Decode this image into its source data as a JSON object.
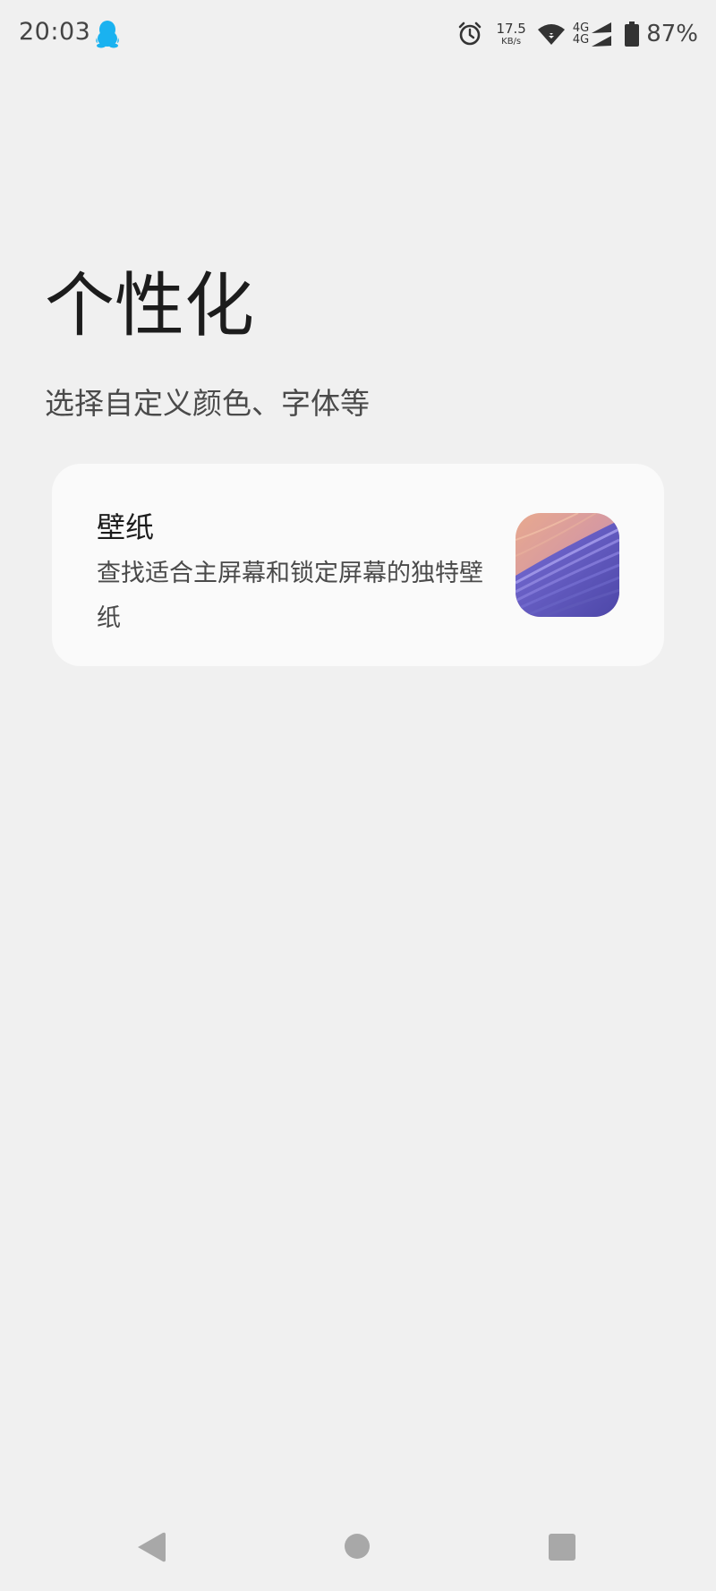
{
  "status_bar": {
    "time": "20:03",
    "net_speed_value": "17.5",
    "net_speed_unit": "KB/s",
    "cell_label_1": "4G",
    "cell_label_2": "4G",
    "battery_text": "87%",
    "battery_level": 0.87,
    "icons": [
      "qq-icon",
      "alarm-icon",
      "wifi-icon",
      "signal-icon",
      "battery-icon"
    ],
    "qq_color": "#1ab2f0"
  },
  "header": {
    "title": "个性化",
    "subtitle": "选择自定义颜色、字体等"
  },
  "wallpaper_card": {
    "title": "壁纸",
    "description": "查找适合主屏幕和锁定屏幕的独特壁纸",
    "thumbnail_colors": [
      "#e8a98e",
      "#c98fa6",
      "#6a5fc8",
      "#4d47a8"
    ]
  },
  "nav_bar": {
    "icons": [
      "back-icon",
      "home-icon",
      "recents-icon"
    ],
    "color": "#a8a8a8"
  },
  "colors": {
    "background": "#f0f0f0",
    "card_background": "#fafafa",
    "text_primary": "#1c1c1c",
    "text_secondary": "#4a4a4a"
  }
}
